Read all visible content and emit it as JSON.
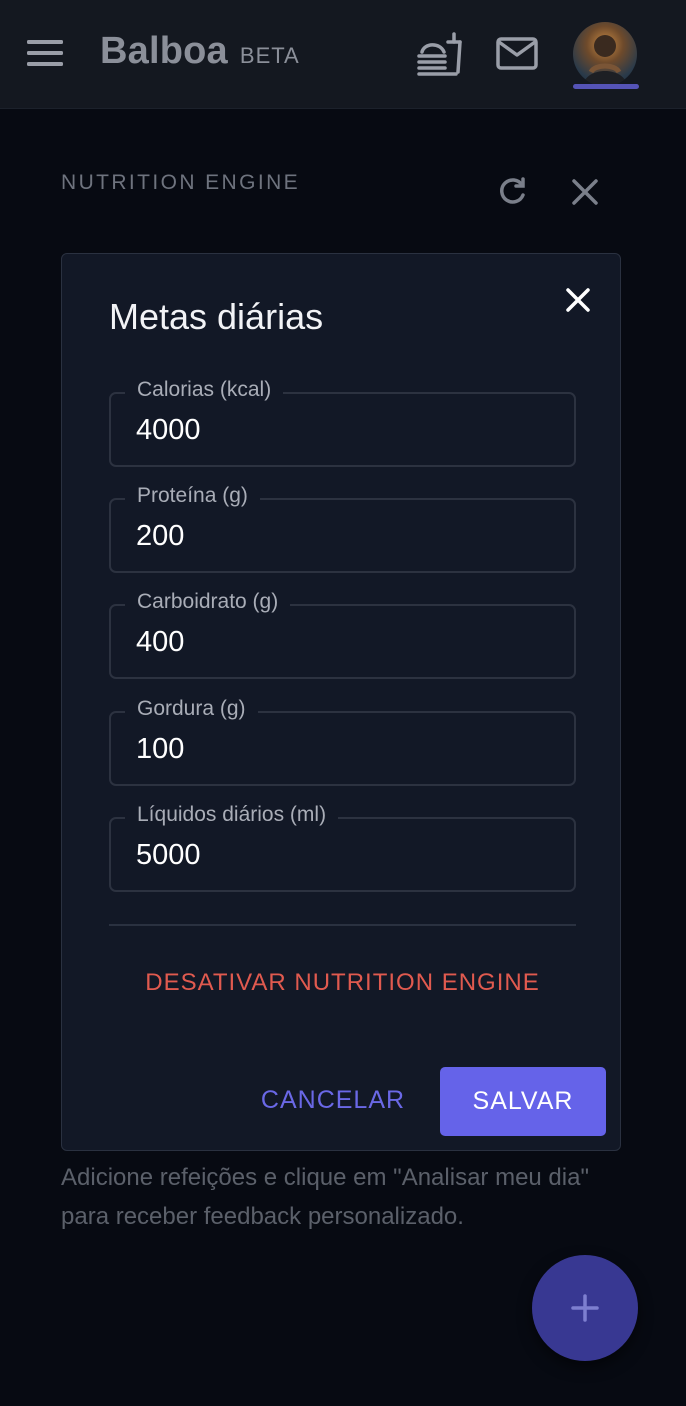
{
  "appbar": {
    "brand": "Balboa",
    "badge": "BETA",
    "icons": {
      "menu": "menu-icon",
      "food": "food-tray-icon",
      "mail": "mail-icon",
      "avatar": "avatar"
    },
    "avatar_underline_color": "#5553b6"
  },
  "page": {
    "section_label": "NUTRITION ENGINE",
    "hint": "Adicione refeições e clique em \"Analisar meu dia\" para receber feedback personalizado.",
    "fab_icon": "plus-icon"
  },
  "dialog": {
    "title": "Metas diárias",
    "fields": [
      {
        "label": "Calorias (kcal)",
        "value": "4000"
      },
      {
        "label": "Proteína (g)",
        "value": "200"
      },
      {
        "label": "Carboidrato (g)",
        "value": "400"
      },
      {
        "label": "Gordura (g)",
        "value": "100"
      },
      {
        "label": "Líquidos diários (ml)",
        "value": "5000"
      }
    ],
    "deactivate_label": "DESATIVAR NUTRITION ENGINE",
    "cancel_label": "CANCELAR",
    "save_label": "SALVAR"
  },
  "colors": {
    "accent": "#6563e9",
    "danger": "#e05a4f",
    "surface": "#121826",
    "background": "#070a12"
  }
}
